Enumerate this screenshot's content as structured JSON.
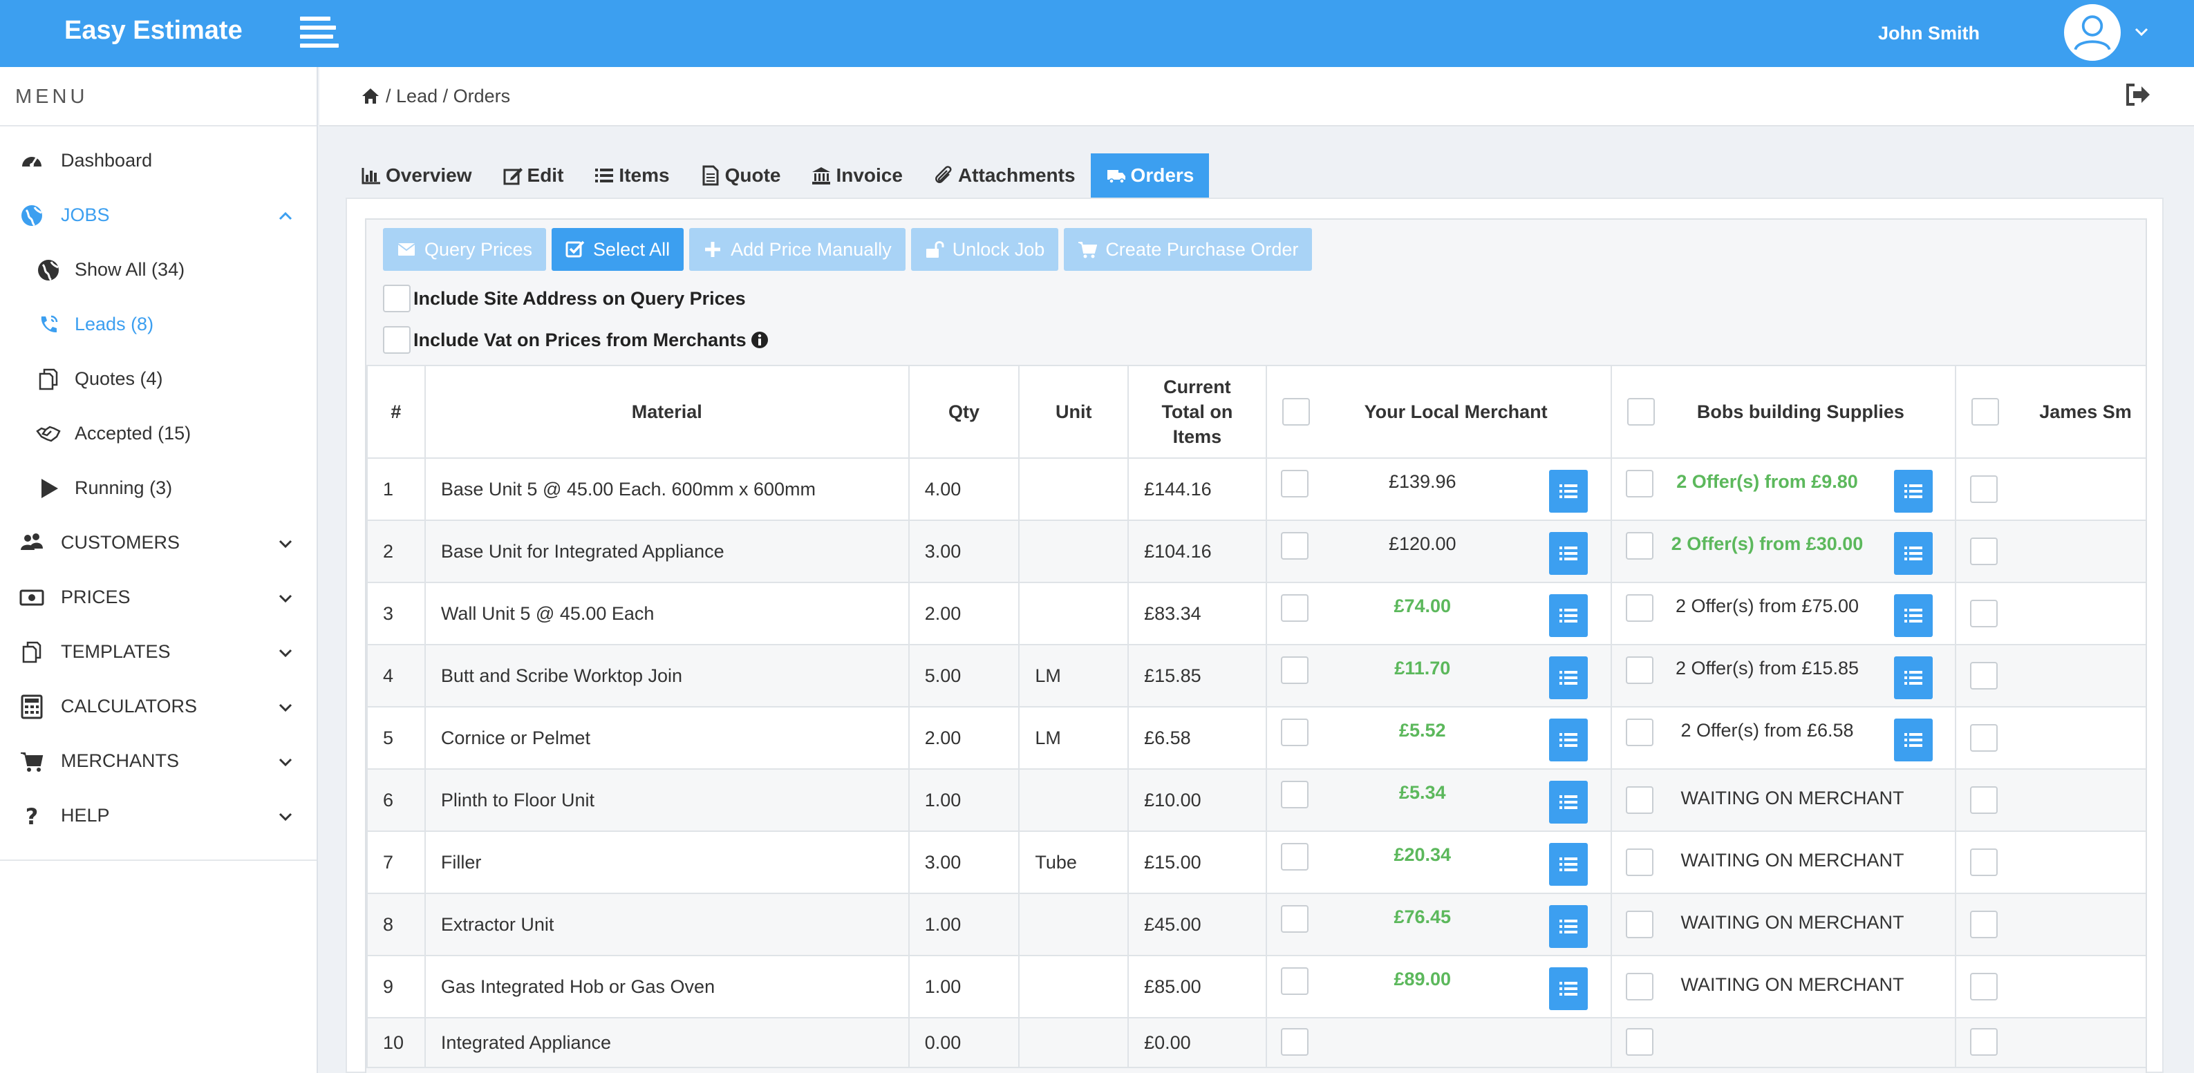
{
  "app": {
    "title": "Easy Estimate"
  },
  "user": {
    "name": "John Smith"
  },
  "sidebar": {
    "heading": "MENU",
    "items": [
      {
        "label": "Dashboard",
        "icon": "gauge-icon"
      },
      {
        "label": "JOBS",
        "icon": "globe-icon"
      },
      {
        "label": "Show All (34)",
        "icon": "globe-icon"
      },
      {
        "label": "Leads (8)",
        "icon": "phone-icon"
      },
      {
        "label": "Quotes (4)",
        "icon": "copy-icon"
      },
      {
        "label": "Accepted (15)",
        "icon": "handshake-icon"
      },
      {
        "label": "Running (3)",
        "icon": "play-icon"
      },
      {
        "label": "CUSTOMERS",
        "icon": "users-icon"
      },
      {
        "label": "PRICES",
        "icon": "money-icon"
      },
      {
        "label": "TEMPLATES",
        "icon": "copy-icon"
      },
      {
        "label": "CALCULATORS",
        "icon": "calculator-icon"
      },
      {
        "label": "MERCHANTS",
        "icon": "cart-icon"
      },
      {
        "label": "HELP",
        "icon": "question-icon"
      }
    ]
  },
  "breadcrumb": {
    "lead": "Lead",
    "orders": "Orders",
    "sep": "/"
  },
  "tabs": [
    "Overview",
    "Edit",
    "Items",
    "Quote",
    "Invoice",
    "Attachments",
    "Orders"
  ],
  "toolbar": {
    "query_prices": "Query Prices",
    "select_all": "Select All",
    "add_price_manually": "Add Price Manually",
    "unlock_job": "Unlock Job",
    "create_purchase_order": "Create Purchase Order"
  },
  "options": {
    "include_site_address": "Include Site Address on Query Prices",
    "include_vat": "Include Vat on Prices from Merchants"
  },
  "table": {
    "headers": {
      "num": "#",
      "material": "Material",
      "qty": "Qty",
      "unit": "Unit",
      "current_total": "Current Total on Items",
      "merchant1": "Your Local Merchant",
      "merchant2": "Bobs building Supplies",
      "merchant3": "James Sm"
    },
    "rows": [
      {
        "num": "1",
        "material": "Base Unit 5 @ 45.00 Each. 600mm x 600mm",
        "qty": "4.00",
        "unit": "",
        "total": "£144.16",
        "m1": "£139.96",
        "m1_green": false,
        "m2": "2 Offer(s) from £9.80",
        "m2_green": true,
        "m2_wait": false
      },
      {
        "num": "2",
        "material": "Base Unit for Integrated Appliance",
        "qty": "3.00",
        "unit": "",
        "total": "£104.16",
        "m1": "£120.00",
        "m1_green": false,
        "m2": "2 Offer(s) from £30.00",
        "m2_green": true,
        "m2_wait": false
      },
      {
        "num": "3",
        "material": "Wall Unit 5 @ 45.00 Each",
        "qty": "2.00",
        "unit": "",
        "total": "£83.34",
        "m1": "£74.00",
        "m1_green": true,
        "m2": "2 Offer(s) from £75.00",
        "m2_green": false,
        "m2_wait": false
      },
      {
        "num": "4",
        "material": "Butt and Scribe Worktop Join",
        "qty": "5.00",
        "unit": "LM",
        "total": "£15.85",
        "m1": "£11.70",
        "m1_green": true,
        "m2": "2 Offer(s) from £15.85",
        "m2_green": false,
        "m2_wait": false
      },
      {
        "num": "5",
        "material": "Cornice or Pelmet",
        "qty": "2.00",
        "unit": "LM",
        "total": "£6.58",
        "m1": "£5.52",
        "m1_green": true,
        "m2": "2 Offer(s) from £6.58",
        "m2_green": false,
        "m2_wait": false
      },
      {
        "num": "6",
        "material": "Plinth to Floor Unit",
        "qty": "1.00",
        "unit": "",
        "total": "£10.00",
        "m1": "£5.34",
        "m1_green": true,
        "m2": "WAITING ON MERCHANT",
        "m2_green": false,
        "m2_wait": true
      },
      {
        "num": "7",
        "material": "Filler",
        "qty": "3.00",
        "unit": "Tube",
        "total": "£15.00",
        "m1": "£20.34",
        "m1_green": true,
        "m2": "WAITING ON MERCHANT",
        "m2_green": false,
        "m2_wait": true
      },
      {
        "num": "8",
        "material": "Extractor Unit",
        "qty": "1.00",
        "unit": "",
        "total": "£45.00",
        "m1": "£76.45",
        "m1_green": true,
        "m2": "WAITING ON MERCHANT",
        "m2_green": false,
        "m2_wait": true
      },
      {
        "num": "9",
        "material": "Gas Integrated Hob or Gas Oven",
        "qty": "1.00",
        "unit": "",
        "total": "£85.00",
        "m1": "£89.00",
        "m1_green": true,
        "m2": "WAITING ON MERCHANT",
        "m2_green": false,
        "m2_wait": true
      },
      {
        "num": "10",
        "material": "Integrated Appliance",
        "qty": "0.00",
        "unit": "",
        "total": "£0.00",
        "m1": "",
        "m1_green": false,
        "m2": "",
        "m2_green": false,
        "m2_wait": false
      }
    ]
  },
  "colors": {
    "accent": "#3c9ff0",
    "green": "#5cb85c",
    "button_disabled": "#a9d3f6"
  }
}
